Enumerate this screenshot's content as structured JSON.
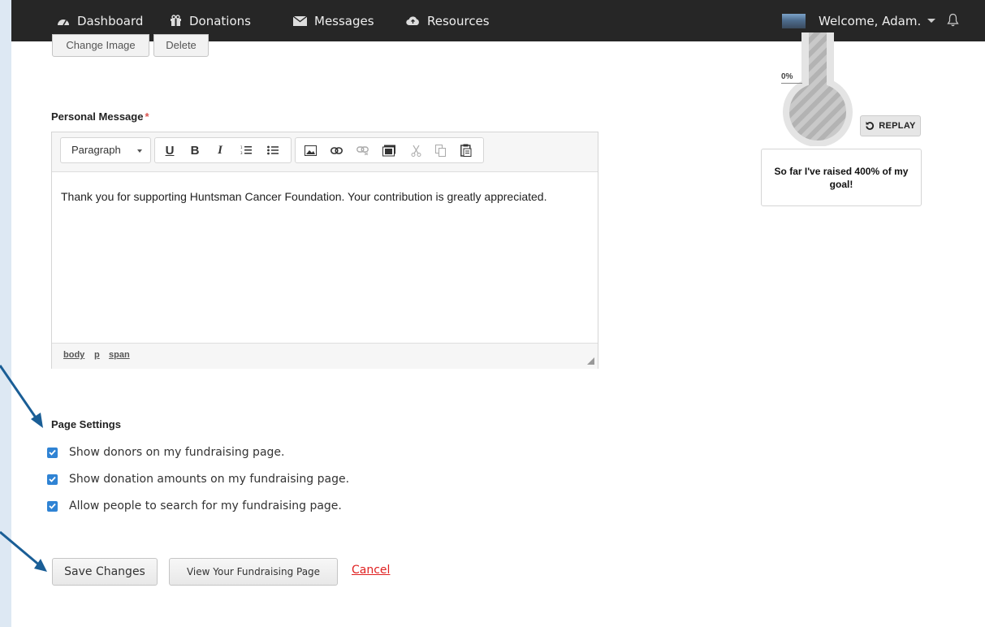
{
  "nav": {
    "items": [
      {
        "label": "Dashboard",
        "icon": "dashboard-icon"
      },
      {
        "label": "Donations",
        "icon": "gift-icon"
      },
      {
        "label": "Messages",
        "icon": "envelope-icon"
      },
      {
        "label": "Resources",
        "icon": "cloud-icon"
      }
    ],
    "welcome": "Welcome, Adam."
  },
  "image_buttons": {
    "change": "Change Image",
    "delete": "Delete"
  },
  "personal_message": {
    "label": "Personal Message",
    "required_mark": "*",
    "format_select": "Paragraph",
    "toolbar_icons": [
      "underline-icon",
      "bold-icon",
      "italic-icon",
      "ordered-list-icon",
      "bullet-list-icon",
      "image-icon",
      "link-icon",
      "unlink-icon",
      "media-icon",
      "cut-icon",
      "copy-icon",
      "paste-icon"
    ],
    "body": "Thank you for supporting Huntsman Cancer Foundation. Your contribution is greatly appreciated.",
    "path": [
      "body",
      "p",
      "span"
    ]
  },
  "page_settings": {
    "label": "Page Settings",
    "options": [
      {
        "label": "Show donors on my fundraising page.",
        "checked": true
      },
      {
        "label": "Show donation amounts on my fundraising page.",
        "checked": true
      },
      {
        "label": "Allow people to search for my fundraising page.",
        "checked": true
      }
    ]
  },
  "actions": {
    "save": "Save Changes",
    "view": "View Your Fundraising Page",
    "cancel": "Cancel"
  },
  "thermometer": {
    "percent_label": "0%",
    "replay": "REPLAY",
    "raised_text": "So far I've raised 400% of my goal!"
  },
  "colors": {
    "accent": "#2f83d4",
    "cancel": "#e02020",
    "navbar": "#262626",
    "arrow": "#1a5e96"
  }
}
